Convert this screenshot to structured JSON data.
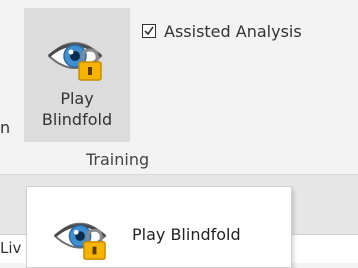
{
  "ribbon": {
    "cut_label": "n",
    "play_blindfold_button": {
      "label_line1": "Play",
      "label_line2": "Blindfold",
      "icon": "eye-lock-icon"
    },
    "assisted_analysis": {
      "label": "Assisted Analysis",
      "checked": true
    },
    "group_label": "Training"
  },
  "dropdown": {
    "item": {
      "label": "Play Blindfold",
      "icon": "eye-lock-icon"
    }
  },
  "background": {
    "tab_fragment": "Liv"
  },
  "colors": {
    "eye_iris": "#3f8fd0",
    "lock_body": "#f4b400",
    "ribbon_bg": "#f3f3f3"
  }
}
